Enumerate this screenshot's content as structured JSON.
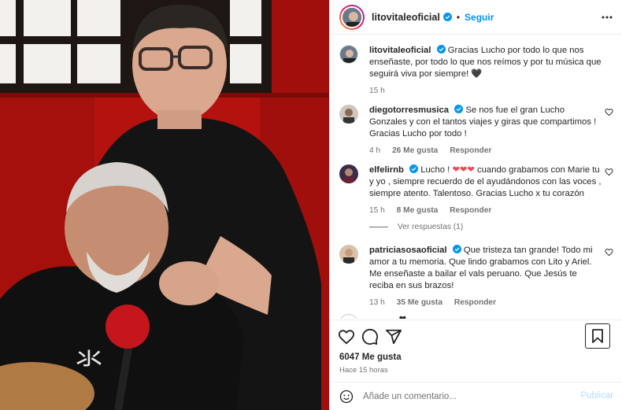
{
  "post": {
    "author": "litovitaleoficial",
    "follow_label": "Seguir",
    "separator": "•",
    "caption": {
      "username": "litovitaleoficial",
      "text": "Gracias Lucho por todo lo que nos enseñaste, por todo lo que nos reímos y por tu música que seguirá viva por siempre! 🖤",
      "time": "15 h"
    }
  },
  "comments": [
    {
      "username": "diegotorresmusica",
      "verified": true,
      "text": "Se nos fue el gran Lucho Gonzales y con el tantos viajes y giras que compartimos ! Gracias Lucho por todo !",
      "time": "4 h",
      "likes": "26 Me gusta",
      "reply": "Responder"
    },
    {
      "username": "elfelirnb",
      "verified": true,
      "text_before": "Lucho !",
      "hearts": "❤❤❤",
      "text_after": "cuando grabamos con Marie tu y yo , siempre recuerdo de el ayudándonos con las voces , siempre atento. Talentoso. Gracias Lucho x tu corazón",
      "time": "15 h",
      "likes": "8 Me gusta",
      "reply": "Responder",
      "view_replies": "Ver respuestas (1)"
    },
    {
      "username": "patriciasosaoficial",
      "verified": true,
      "text": "Que tristeza tan grande! Todo mi amor a tu memoria. Que lindo grabamos con Lito y Ariel. Me enseñaste a bailar el vals peruano. Que Jesús te reciba en sus brazos!",
      "time": "13 h",
      "likes": "35 Me gusta",
      "reply": "Responder"
    }
  ],
  "partial_comment": {
    "text": "... ... ... ❤"
  },
  "footer": {
    "likes": "6047 Me gusta",
    "time": "Hace 15 horas",
    "comment_placeholder": "Añade un comentario...",
    "publish_label": "Publicar"
  },
  "icons": {
    "like": "heart-icon",
    "comment": "comment-icon",
    "share": "share-icon",
    "save": "bookmark-icon",
    "emoji": "emoji-icon",
    "more": "more-icon",
    "verified": "verified-badge-icon"
  },
  "colors": {
    "accent": "#0095f6",
    "verified": "#0095f6",
    "muted": "#737373",
    "heart": "#ed4956",
    "photo_background": "#b3120f"
  }
}
